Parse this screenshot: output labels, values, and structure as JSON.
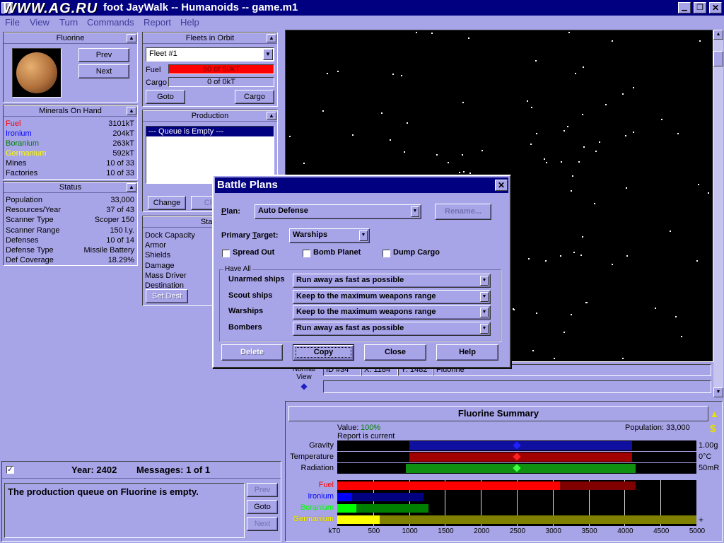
{
  "titlebar": {
    "watermark": "WWW.AG.RU",
    "title": "foot JayWalk -- Humanoids -- game.m1"
  },
  "menu": [
    "File",
    "View",
    "Turn",
    "Commands",
    "Report",
    "Help"
  ],
  "planet_panel": {
    "name": "Fluorine",
    "prev": "Prev",
    "next": "Next"
  },
  "fleets_panel": {
    "title": "Fleets in Orbit",
    "selected_fleet": "Fleet #1",
    "fuel_label": "Fuel",
    "fuel_value": "50 of 50kT",
    "cargo_label": "Cargo",
    "cargo_value": "0 of 0kT",
    "goto": "Goto",
    "cargo_btn": "Cargo"
  },
  "minerals_panel": {
    "title": "Minerals On Hand",
    "rows": [
      {
        "label": "Fuel",
        "value": "3101kT",
        "color": "#ff0000"
      },
      {
        "label": "Ironium",
        "value": "204kT",
        "color": "#0000ff"
      },
      {
        "label": "Boranium",
        "value": "263kT",
        "color": "#008000"
      },
      {
        "label": "Germanium",
        "value": "592kT",
        "color": "#ffff00"
      },
      {
        "label": "Mines",
        "value": "10 of 33",
        "color": "#000000"
      },
      {
        "label": "Factories",
        "value": "10 of 33",
        "color": "#000000"
      }
    ]
  },
  "status_panel": {
    "title": "Status",
    "rows": [
      {
        "label": "Population",
        "value": "33,000"
      },
      {
        "label": "Resources/Year",
        "value": "37 of 43"
      },
      {
        "label": "Scanner Type",
        "value": "Scoper 150"
      },
      {
        "label": "Scanner Range",
        "value": "150 l.y."
      },
      {
        "label": "Defenses",
        "value": "10 of 14"
      },
      {
        "label": "Defense Type",
        "value": "Missile Battery"
      },
      {
        "label": "Def Coverage",
        "value": "18.29%"
      }
    ]
  },
  "production_panel": {
    "title": "Production",
    "queue_item": "--- Queue is Empty ---",
    "change": "Change",
    "clear": "Cle"
  },
  "starbase_panel": {
    "title": "Starb",
    "rows": [
      "Dock Capacity",
      "Armor",
      "Shields",
      "Damage",
      "Mass Driver",
      "Destination"
    ],
    "set_dest": "Set Dest"
  },
  "messages": {
    "year_label": "Year: 2402",
    "messages_label": "Messages: 1 of 1",
    "text": "The production queue on Fluorine is empty.",
    "prev": "Prev",
    "goto": "Goto",
    "next": "Next"
  },
  "map_status": {
    "view_line1": "Normal",
    "view_line2": "View",
    "id": "ID #34",
    "x": "X: 1184",
    "y": "Y: 1482",
    "name": "Fluorine"
  },
  "summary": {
    "title": "Fluorine Summary",
    "value_label": "Value:",
    "value_pct": "100%",
    "report": "Report is current",
    "population": "Population:  33,000",
    "env": [
      {
        "label": "Gravity",
        "readout": "1.00g",
        "range": [
          0.2,
          0.82
        ],
        "marker": 0.5,
        "band": "#1010a0",
        "mark": "#2020ff"
      },
      {
        "label": "Temperature",
        "readout": "0°C",
        "range": [
          0.2,
          0.82
        ],
        "marker": 0.5,
        "band": "#a00000",
        "mark": "#ff2020"
      },
      {
        "label": "Radiation",
        "readout": "50mR",
        "range": [
          0.19,
          0.83
        ],
        "marker": 0.5,
        "band": "#109010",
        "mark": "#40ff40"
      }
    ],
    "mineral_bars": [
      {
        "label": "Fuel",
        "color": "#ff0000",
        "on_hand": 3101,
        "concentration": 4150,
        "conc_color": "#800000"
      },
      {
        "label": "Ironium",
        "color": "#0000ff",
        "on_hand": 204,
        "concentration": 1200,
        "conc_color": "#000080"
      },
      {
        "label": "Boranium",
        "color": "#00ff00",
        "on_hand": 263,
        "concentration": 1270,
        "conc_color": "#008000"
      },
      {
        "label": "Germanium",
        "color": "#ffff00",
        "on_hand": 592,
        "concentration": 5000,
        "conc_color": "#808000"
      }
    ],
    "axis_ticks": [
      "kT0",
      "500",
      "1000",
      "1500",
      "2000",
      "2500",
      "3000",
      "3500",
      "4000",
      "4500",
      "5000"
    ],
    "axis_max": 5000,
    "plus": "+"
  },
  "dialog": {
    "title": "Battle Plans",
    "plan_label": "Plan:",
    "plan_value": "Auto Defense",
    "rename": "Rename...",
    "primary_label": "Primary Target:",
    "primary_value": "Warships",
    "spread_out": "Spread Out",
    "bomb_planet": "Bomb Planet",
    "dump_cargo": "Dump Cargo",
    "group_label": "Have All",
    "tactics": [
      {
        "label": "Unarmed ships",
        "value": "Run away as fast as possible"
      },
      {
        "label": "Scout ships",
        "value": "Keep to the maximum weapons range"
      },
      {
        "label": "Warships",
        "value": "Keep to the maximum weapons range"
      },
      {
        "label": "Bombers",
        "value": "Run away as fast as possible"
      }
    ],
    "delete": "Delete",
    "copy": "Copy",
    "close": "Close",
    "help": "Help"
  },
  "colors": {
    "bg": "#a8a4e8",
    "space": "#000000",
    "title_blue": "#000080"
  }
}
